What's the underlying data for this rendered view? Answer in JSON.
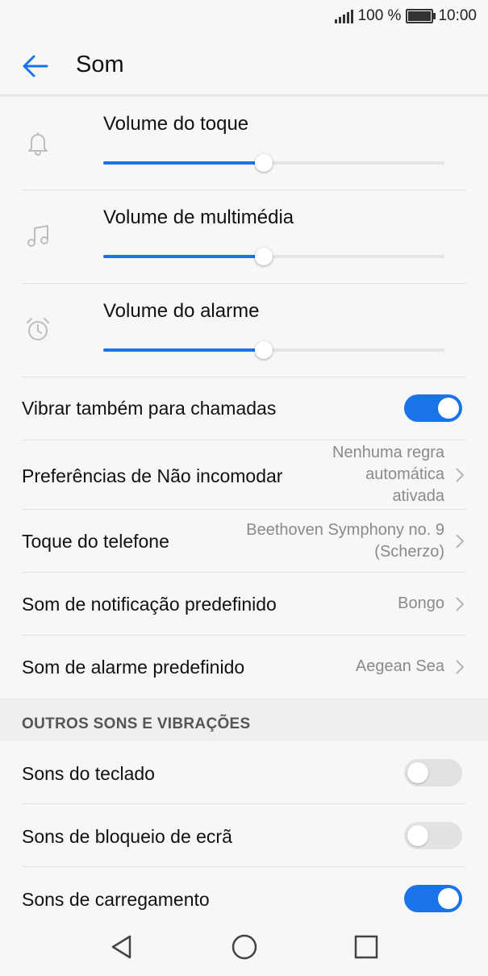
{
  "status": {
    "battery": "100 %",
    "time": "10:00"
  },
  "header": {
    "title": "Som"
  },
  "volumes": [
    {
      "label": "Volume do toque",
      "icon": "bell-icon",
      "level": 0.47
    },
    {
      "label": "Volume de multimédia",
      "icon": "music-note-icon",
      "level": 0.47
    },
    {
      "label": "Volume do alarme",
      "icon": "alarm-clock-icon",
      "level": 0.47
    }
  ],
  "settings": {
    "vibrate": {
      "label": "Vibrar também para chamadas",
      "on": true
    },
    "dnd": {
      "label": "Preferências de Não incomodar",
      "value_lines": [
        "Nenhuma regra",
        "automática",
        "ativada"
      ]
    },
    "ringtone": {
      "label": "Toque do telefone",
      "value_lines": [
        "Beethoven Symphony no. 9",
        "(Scherzo)"
      ]
    },
    "notification": {
      "label": "Som de notificação predefinido",
      "value": "Bongo"
    },
    "alarm": {
      "label": "Som de alarme predefinido",
      "value": "Aegean Sea"
    }
  },
  "other": {
    "title": "OUTROS SONS E VIBRAÇÕES",
    "items": [
      {
        "label": "Sons do teclado",
        "on": false
      },
      {
        "label": "Sons de bloqueio de ecrã",
        "on": false
      },
      {
        "label": "Sons de carregamento",
        "on": true
      }
    ]
  },
  "colors": {
    "accent": "#1a73e8",
    "toggle_off": "#e2e2e2",
    "section_bg": "#efefef"
  }
}
